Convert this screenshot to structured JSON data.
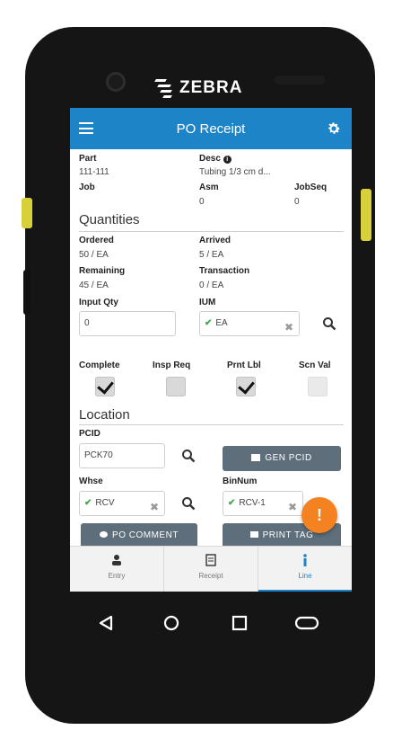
{
  "device": {
    "brand": "ZEBRA"
  },
  "appbar": {
    "title": "PO Receipt"
  },
  "fields": {
    "part_label": "Part",
    "part_value": "111-111",
    "desc_label": "Desc",
    "desc_value": "Tubing 1/3 cm d...",
    "job_label": "Job",
    "asm_label": "Asm",
    "asm_value": "0",
    "jobseq_label": "JobSeq",
    "jobseq_value": "0"
  },
  "quantities": {
    "heading": "Quantities",
    "ordered_label": "Ordered",
    "ordered_value": "50 / EA",
    "arrived_label": "Arrived",
    "arrived_value": "5 / EA",
    "remaining_label": "Remaining",
    "remaining_value": "45 / EA",
    "transaction_label": "Transaction",
    "transaction_value": "0 / EA",
    "input_qty_label": "Input Qty",
    "input_qty_value": "0",
    "ium_label": "IUM",
    "ium_value": "EA"
  },
  "checkboxes": [
    {
      "label": "Complete",
      "checked": true
    },
    {
      "label": "Insp Req",
      "checked": false
    },
    {
      "label": "Prnt Lbl",
      "checked": true
    },
    {
      "label": "Scn Val",
      "checked": false
    }
  ],
  "location": {
    "heading": "Location",
    "pcid_label": "PCID",
    "pcid_value": "PCK70",
    "gen_pcid_label": "GEN PCID",
    "whse_label": "Whse",
    "whse_value": "RCV",
    "binnum_label": "BinNum",
    "binnum_value": "RCV-1",
    "po_comment_label": "PO COMMENT",
    "print_tag_label": "PRINT TAG"
  },
  "fab": {
    "label": "!"
  },
  "tabs": [
    {
      "label": "Entry",
      "icon": "user-icon"
    },
    {
      "label": "Receipt",
      "icon": "document-icon"
    },
    {
      "label": "Line",
      "icon": "info-icon",
      "active": true
    }
  ],
  "colors": {
    "appbar": "#1d84c7",
    "fab": "#f58220",
    "button": "#5e6f7b",
    "check": "#3aa94a"
  }
}
